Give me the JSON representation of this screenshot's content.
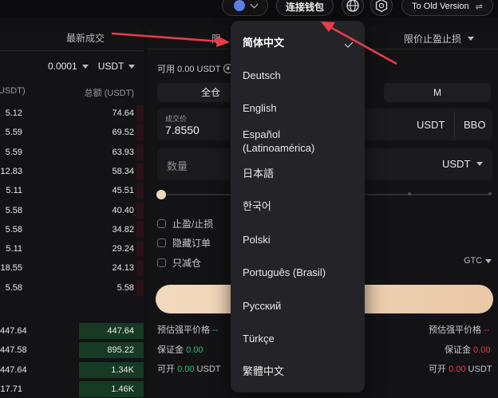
{
  "topbar": {
    "connect_wallet": "连接钱包",
    "old_version": "To Old Version",
    "switch_icon": "⇌"
  },
  "orderbook": {
    "tab_trades": "最新成交",
    "precision": "0.0001",
    "currency": "USDT",
    "col_amount": "USDT)",
    "col_total": "总额 (USDT)",
    "asks": [
      {
        "amt": "5.12",
        "total": "74.64",
        "depth": 0.05
      },
      {
        "amt": "5.59",
        "total": "69.52",
        "depth": 0.05
      },
      {
        "amt": "5.59",
        "total": "63.93",
        "depth": 0.05
      },
      {
        "amt": "12.83",
        "total": "58.34",
        "depth": 0.05
      },
      {
        "amt": "5.11",
        "total": "45.51",
        "depth": 0.05
      },
      {
        "amt": "5.58",
        "total": "40.40",
        "depth": 0.05
      },
      {
        "amt": "5.58",
        "total": "34.82",
        "depth": 0.05
      },
      {
        "amt": "5.11",
        "total": "29.24",
        "depth": 0.05
      },
      {
        "amt": "18.55",
        "total": "24.13",
        "depth": 0.05
      },
      {
        "amt": "5.58",
        "total": "5.58",
        "depth": 0.05
      }
    ],
    "bids": [
      {
        "amt": "447.64",
        "total": "447.64",
        "depth": 0.45
      },
      {
        "amt": "447.58",
        "total": "895.22",
        "depth": 0.45
      },
      {
        "amt": "447.64",
        "total": "1.34K",
        "depth": 0.45
      },
      {
        "amt": "17.71",
        "total": "1.46K",
        "depth": 0.45
      }
    ]
  },
  "order_form": {
    "tab_limit_tpsl": "限价止盈止损",
    "available": "可用 0.00 USDT",
    "margin_cross": "全仓",
    "margin_m": "M",
    "price_label": "成交价",
    "price_value": "7.8550",
    "price_unit": "USDT",
    "bbo": "BBO",
    "qty_placeholder": "数量",
    "qty_unit": "USDT",
    "checkbox_tpsl": "止盈/止损",
    "checkbox_hidden": "隐藏订单",
    "checkbox_reduce": "只减仓",
    "tif": "GTC",
    "liq_price_label": "预估强平价格",
    "liq_price_value": "--",
    "margin_label": "保证金",
    "margin_value": "0.00",
    "open_label": "可开",
    "open_value": "0.00",
    "open_unit": "USDT"
  },
  "language_menu": {
    "items": [
      "简体中文",
      "Deutsch",
      "English",
      "Español",
      "(Latinoamérica)",
      "日本語",
      "한국어",
      "Polski",
      "Português (Brasil)",
      "Русский",
      "Türkçe",
      "繁體中文"
    ],
    "selected": "简体中文"
  },
  "colors": {
    "accent_gradient_start": "#f2d9bd",
    "buy_green": "#2fc27a",
    "sell_red": "#ef3b46",
    "annotation_arrow": "#ea3c4b"
  }
}
